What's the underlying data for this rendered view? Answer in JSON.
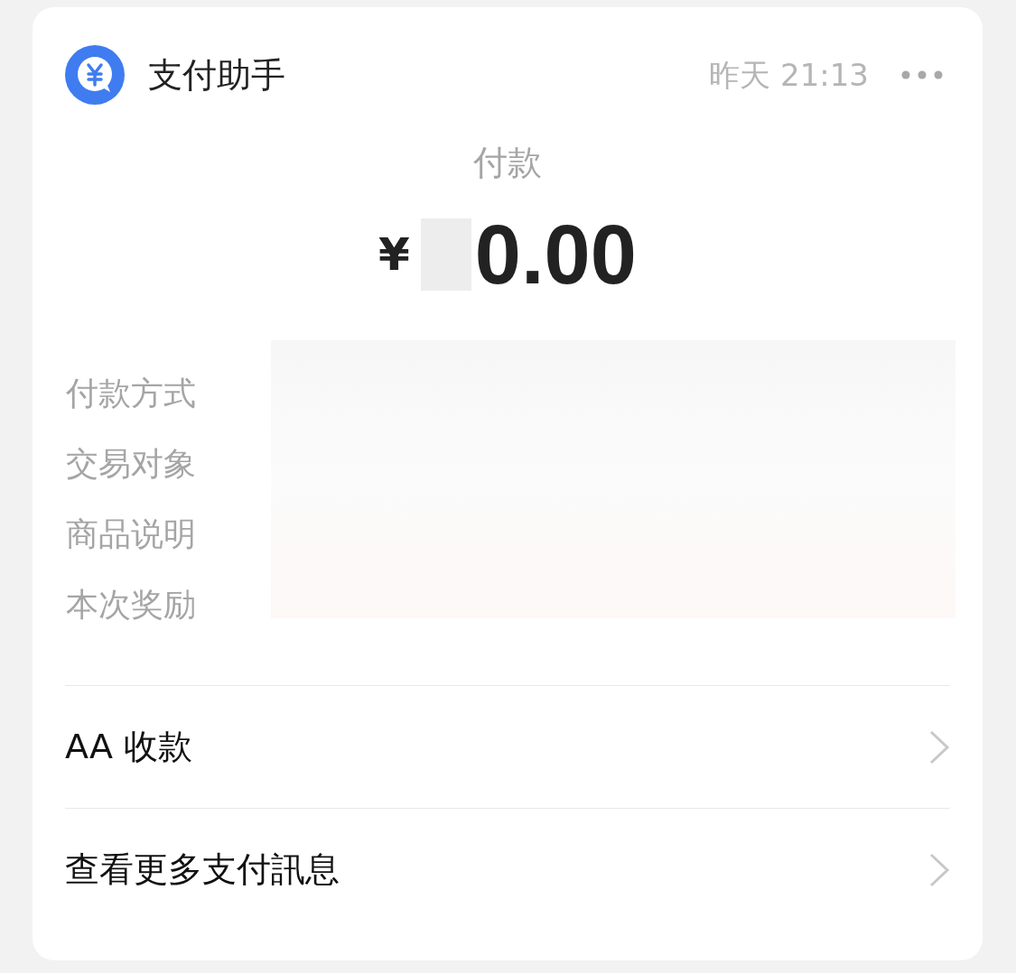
{
  "header": {
    "title": "支付助手",
    "time": "昨天 21:13"
  },
  "payment": {
    "label": "付款",
    "currency": "¥",
    "amount": "0.00"
  },
  "details": [
    {
      "label": "付款方式"
    },
    {
      "label": "交易对象"
    },
    {
      "label": "商品说明"
    },
    {
      "label": "本次奖励"
    }
  ],
  "links": [
    {
      "label": "AA 收款"
    },
    {
      "label": "查看更多支付訊息"
    }
  ]
}
